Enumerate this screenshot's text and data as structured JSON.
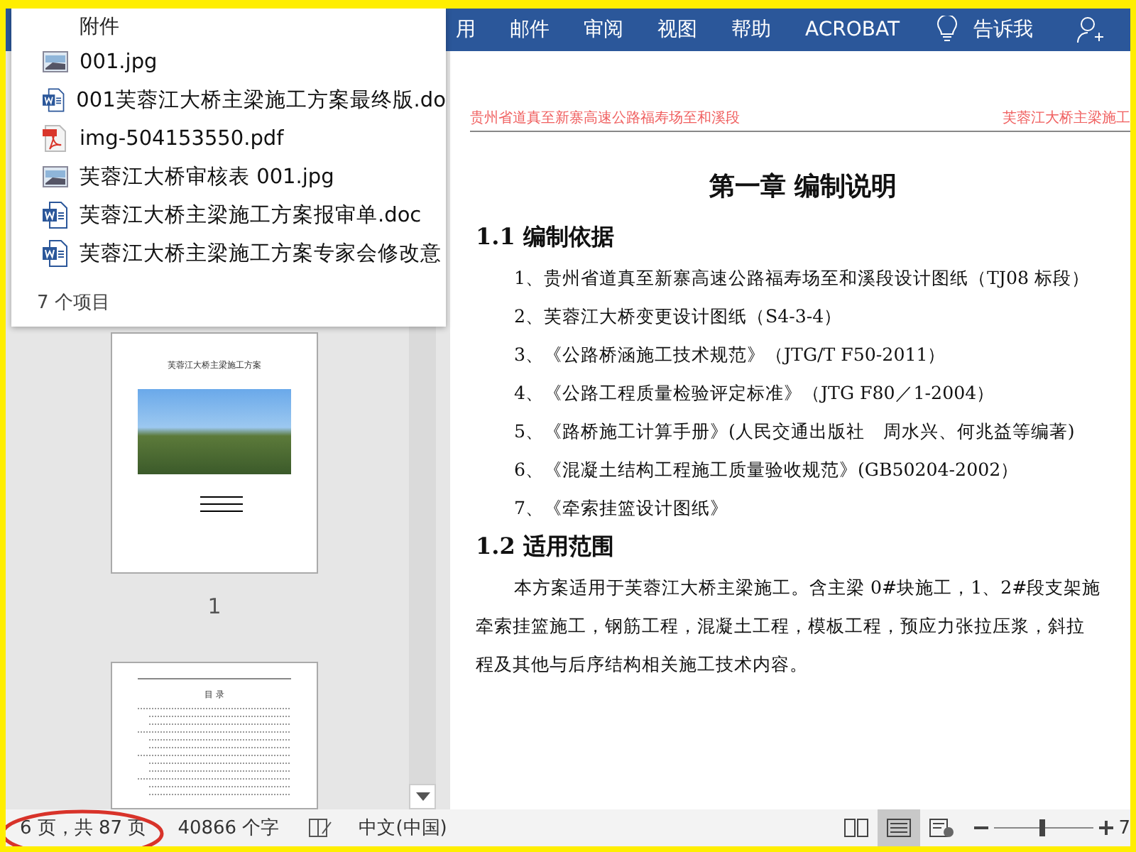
{
  "ribbon": {
    "tabs": [
      {
        "label": "用"
      },
      {
        "label": "邮件"
      },
      {
        "label": "审阅"
      },
      {
        "label": "视图"
      },
      {
        "label": "帮助"
      },
      {
        "label": "ACROBAT"
      }
    ],
    "tell_me": "告诉我"
  },
  "attachments_popup": {
    "title": "附件",
    "files": [
      {
        "name": "001.jpg",
        "kind": "image"
      },
      {
        "name": "001芙蓉江大桥主梁施工方案最终版.do",
        "kind": "word"
      },
      {
        "name": "img-504153550.pdf",
        "kind": "pdf"
      },
      {
        "name": "芙蓉江大桥审核表 001.jpg",
        "kind": "image"
      },
      {
        "name": "芙蓉江大桥主梁施工方案报审单.doc",
        "kind": "word"
      },
      {
        "name": "芙蓉江大桥主梁施工方案专家会修改意",
        "kind": "word"
      }
    ],
    "count": "7 个项目"
  },
  "navigation": {
    "pages": [
      {
        "kind": "cover",
        "title": "芙蓉江大桥主梁施工方案",
        "label": "1"
      },
      {
        "kind": "toc",
        "title": "目 录"
      }
    ]
  },
  "document": {
    "header_left": "贵州省道真至新寨高速公路福寿场至和溪段",
    "header_right": "芙蓉江大桥主梁施工",
    "title": "第一章 编制说明",
    "sections": [
      {
        "heading": "1.1 编制依据",
        "kind": "list",
        "lines": [
          "1、贵州省道真至新寨高速公路福寿场至和溪段设计图纸（TJ08 标段）",
          "2、芙蓉江大桥变更设计图纸（S4-3-4）",
          "3、《公路桥涵施工技术规范》（JTG/T F50-2011）",
          "4、《公路工程质量检验评定标准》（JTG F80／1-2004）",
          "5、《路桥施工计算手册》(人民交通出版社　周水兴、何兆益等编著)",
          "6、《混凝土结构工程施工质量验收规范》(GB50204-2002）",
          "7、《牵索挂篮设计图纸》"
        ]
      },
      {
        "heading": "1.2 适用范围",
        "kind": "paragraph",
        "lines": [
          "本方案适用于芙蓉江大桥主梁施工。含主梁 0#块施工，1、2#段支架施",
          "牵索挂篮施工，钢筋工程，混凝土工程，模板工程，预应力张拉压浆，斜拉",
          "程及其他与后序结构相关施工技术内容。"
        ]
      }
    ]
  },
  "status_bar": {
    "page": "6 页，共 87 页",
    "words": "40866 个字",
    "language": "中文(中国)",
    "zoom": "7"
  }
}
